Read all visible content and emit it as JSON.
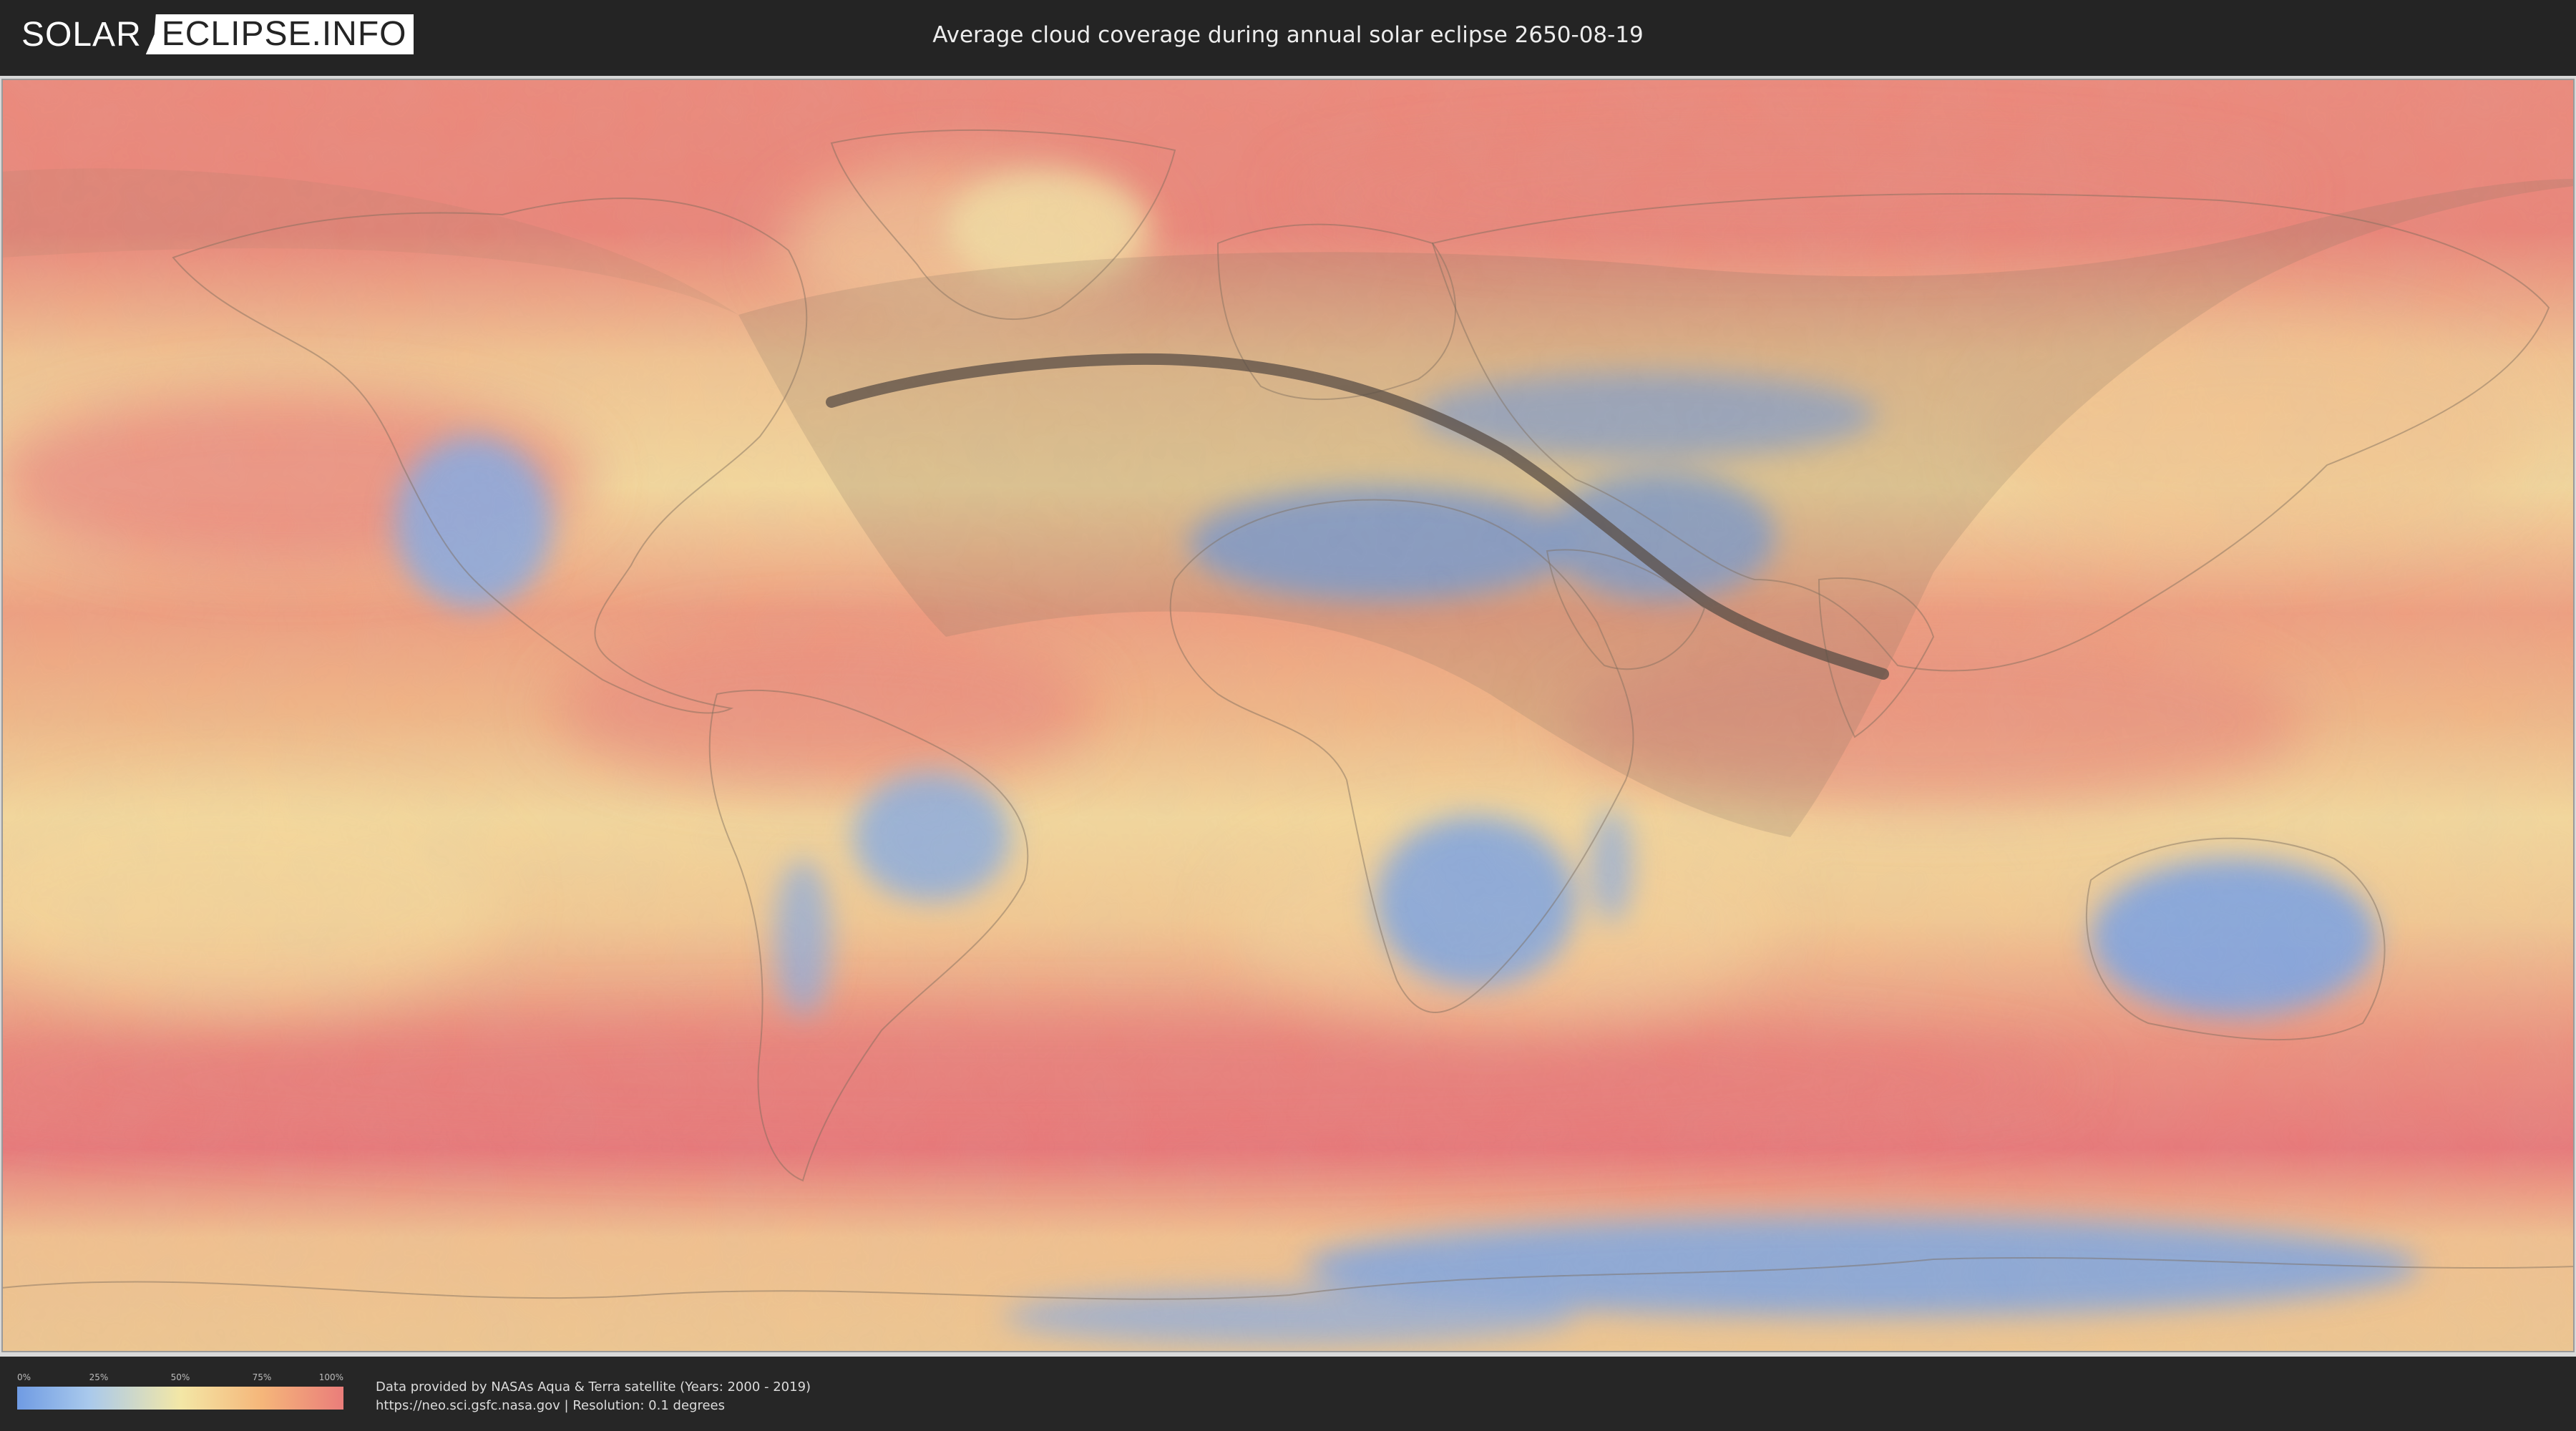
{
  "header": {
    "logo_left": "SOLAR",
    "logo_right": "ECLIPSE.INFO",
    "title": "Average cloud coverage during annual solar eclipse 2650-08-19"
  },
  "legend": {
    "ticks": [
      "0%",
      "25%",
      "50%",
      "75%",
      "100%"
    ],
    "color_low": "#6f9be3",
    "color_mid": "#f3e7a6",
    "color_high": "#ea7d7a"
  },
  "credits": {
    "line1": "Data provided by NASAs Aqua & Terra satellite (Years: 2000 - 2019)",
    "line2": "https://neo.sci.gsfc.nasa.gov | Resolution: 0.1 degrees"
  },
  "map": {
    "projection": "equirectangular",
    "layers": [
      "cloud-coverage",
      "country-borders",
      "penumbra-region",
      "central-path"
    ]
  }
}
